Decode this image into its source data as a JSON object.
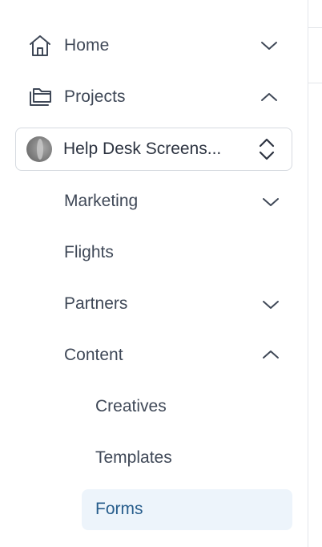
{
  "sidebar": {
    "home": {
      "label": "Home",
      "icon": "home-icon",
      "state": "collapsed"
    },
    "projects": {
      "label": "Projects",
      "icon": "folders-icon",
      "state": "expanded"
    },
    "project_selector": {
      "value": "Help Desk Screens...",
      "icon": "project-avatar"
    },
    "project_items": [
      {
        "label": "Marketing",
        "state": "collapsed"
      },
      {
        "label": "Flights"
      },
      {
        "label": "Partners",
        "state": "collapsed"
      },
      {
        "label": "Content",
        "state": "expanded"
      }
    ],
    "content_items": [
      {
        "label": "Creatives"
      },
      {
        "label": "Templates"
      },
      {
        "label": "Forms",
        "active": true
      }
    ]
  },
  "colors": {
    "text": "#3f4857",
    "active_text": "#275d8c",
    "active_bg": "#edf4fb",
    "border": "#d6dae0"
  }
}
